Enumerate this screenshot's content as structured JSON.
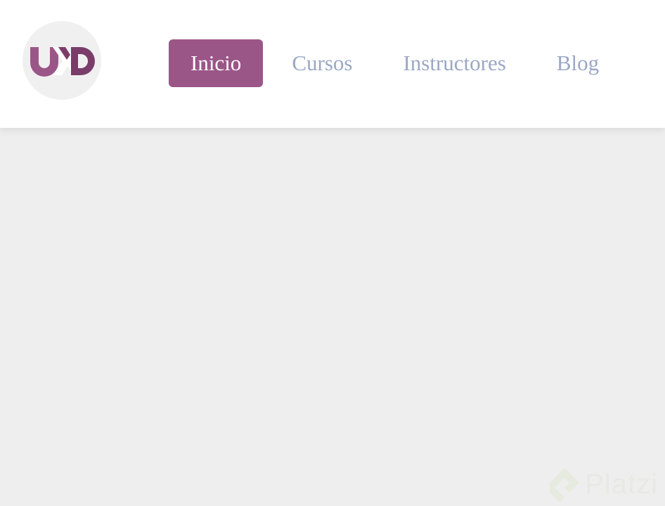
{
  "logo": {
    "text": "UXD",
    "colors": {
      "primary": "#9b5688",
      "dark": "#7a3d6a",
      "background": "#f1f0f1"
    }
  },
  "nav": {
    "items": [
      {
        "label": "Inicio",
        "active": true
      },
      {
        "label": "Cursos",
        "active": false
      },
      {
        "label": "Instructores",
        "active": false
      },
      {
        "label": "Blog",
        "active": false
      }
    ]
  },
  "watermark": {
    "text": "Platzi"
  },
  "colors": {
    "accent": "#9b5688",
    "nav_text": "#9aa8c5",
    "page_background": "#eeeeee",
    "header_background": "#ffffff"
  }
}
